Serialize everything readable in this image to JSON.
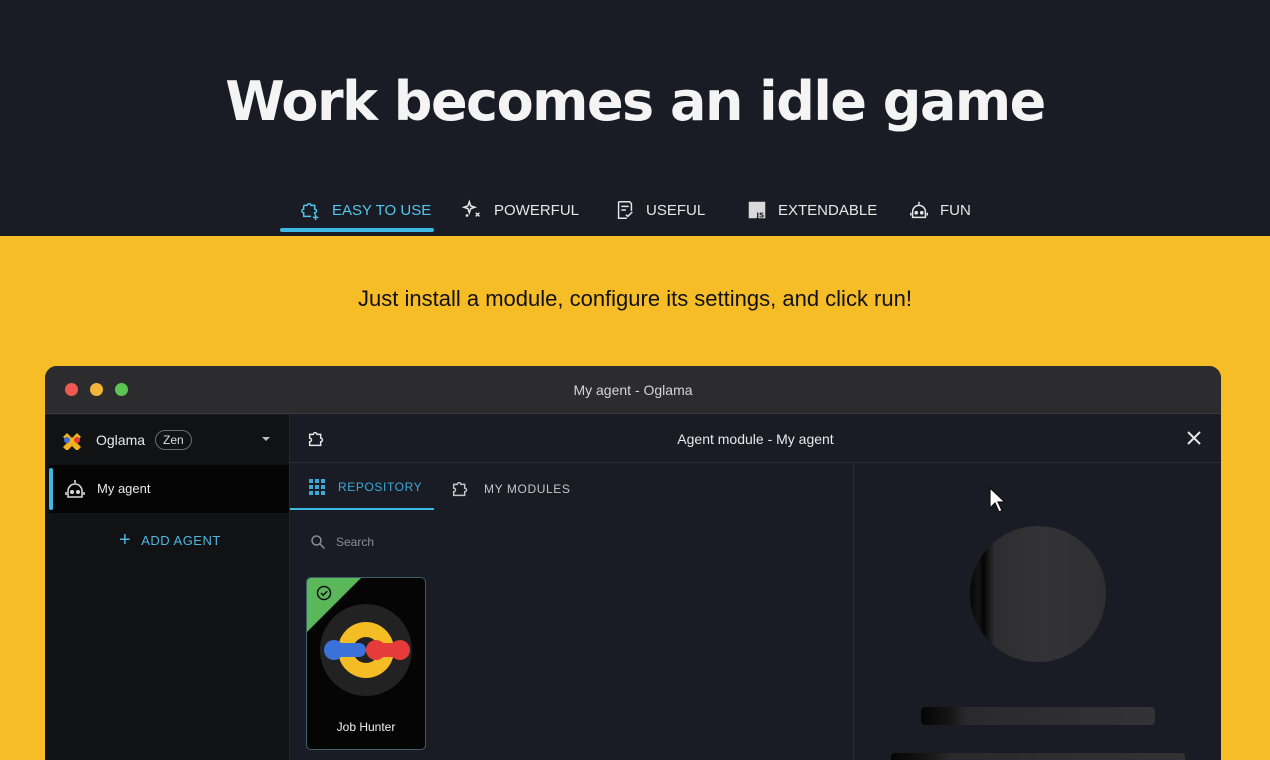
{
  "hero": {
    "title": "Work becomes an idle game",
    "tabs": [
      {
        "label": "EASY TO USE",
        "icon": "puzzle-plus-icon",
        "active": true
      },
      {
        "label": "POWERFUL",
        "icon": "sparkles-icon",
        "active": false
      },
      {
        "label": "USEFUL",
        "icon": "task-document-icon",
        "active": false
      },
      {
        "label": "EXTENDABLE",
        "icon": "js-file-icon",
        "active": false
      },
      {
        "label": "FUN",
        "icon": "robot-icon",
        "active": false
      }
    ],
    "accent": "#3db8e2",
    "background": "#191c24"
  },
  "section": {
    "subtitle": "Just install a module, configure its settings, and click run!",
    "background": "#f6bd27"
  },
  "window": {
    "title": "My agent - Oglama",
    "sidebar": {
      "org_name": "Oglama",
      "org_badge": "Zen",
      "agents": [
        {
          "label": "My agent",
          "icon": "robot-icon",
          "selected": true
        }
      ],
      "add_agent_label": "ADD AGENT"
    },
    "panel": {
      "title": "Agent module - My agent",
      "tabs": [
        {
          "label": "REPOSITORY",
          "icon": "grid-icon",
          "active": true
        },
        {
          "label": "MY MODULES",
          "icon": "puzzle-icon",
          "active": false
        }
      ],
      "search_placeholder": "Search",
      "modules": [
        {
          "label": "Job Hunter",
          "installed": true
        }
      ]
    }
  }
}
